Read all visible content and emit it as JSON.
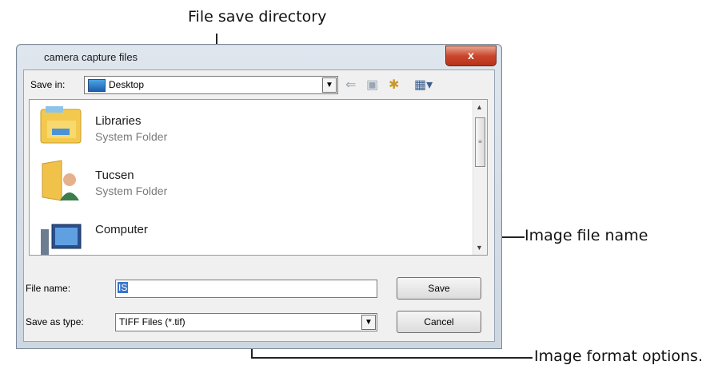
{
  "annotations": {
    "save_directory": "File save directory",
    "file_name": "Image file name",
    "format_options": "Image format options."
  },
  "dialog": {
    "title": "camera capture files",
    "close_symbol": "x",
    "save_in_label": "Save in:",
    "save_in_value": "Desktop",
    "file_name_label": "File name:",
    "file_name_value": "IS",
    "save_as_type_label": "Save as type:",
    "save_as_type_value": "TIFF Files (*.tif)",
    "save_button": "Save",
    "cancel_button": "Cancel"
  },
  "file_list": [
    {
      "name": "Libraries",
      "type": "System Folder",
      "icon": "libraries-folder-icon"
    },
    {
      "name": "Tucsen",
      "type": "System Folder",
      "icon": "user-folder-icon"
    },
    {
      "name": "Computer",
      "type": "",
      "icon": "computer-icon"
    }
  ],
  "colors": {
    "close_button": "#c9472d",
    "selection": "#3a74c8"
  }
}
